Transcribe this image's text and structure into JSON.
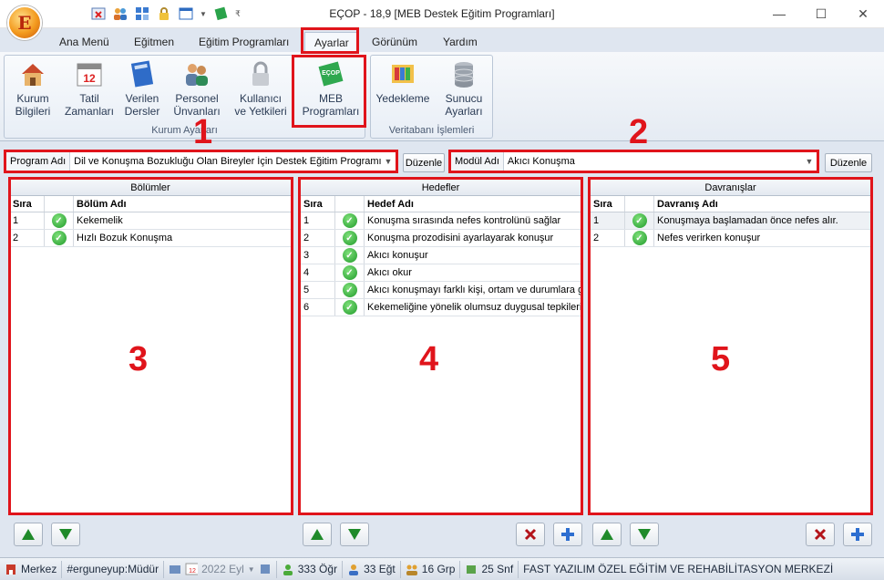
{
  "window": {
    "title": "EÇOP - 18,9 [MEB Destek Eğitim Programları]",
    "controls": [
      "minimize",
      "maximize",
      "close"
    ]
  },
  "app_orb_letter": "E",
  "qat_icons": [
    "delete-icon",
    "users-icon",
    "grid-icon",
    "lock-icon",
    "window-icon",
    "book-icon"
  ],
  "menu": {
    "tabs": [
      {
        "label": "Ana Menü"
      },
      {
        "label": "Eğitmen"
      },
      {
        "label": "Eğitim Programları"
      },
      {
        "label": "Ayarlar",
        "active": true
      },
      {
        "label": "Görünüm"
      },
      {
        "label": "Yardım"
      }
    ]
  },
  "ribbon": {
    "group1": {
      "label": "Kurum Ayarları",
      "buttons": [
        {
          "label1": "Kurum",
          "label2": "Bilgileri",
          "icon": "house-icon"
        },
        {
          "label1": "Tatil",
          "label2": "Zamanları",
          "icon": "calendar-icon"
        },
        {
          "label1": "Verilen",
          "label2": "Dersler",
          "icon": "book-icon"
        },
        {
          "label1": "Personel",
          "label2": "Ünvanları",
          "icon": "people-icon"
        },
        {
          "label1": "Kullanıcı",
          "label2": "ve Yetkileri",
          "icon": "lock-icon"
        },
        {
          "label1": "MEB",
          "label2": "Programları",
          "icon": "meb-book-icon"
        }
      ]
    },
    "group2": {
      "label": "Veritabanı İşlemleri",
      "buttons": [
        {
          "label1": "Yedekleme",
          "label2": "",
          "icon": "backup-icon"
        },
        {
          "label1": "Sunucu",
          "label2": "Ayarları",
          "icon": "database-icon"
        }
      ]
    }
  },
  "program": {
    "label": "Program Adı",
    "value": "Dil ve Konuşma Bozukluğu Olan Bireyler İçin Destek Eğitim Programı",
    "edit_label": "Düzenle"
  },
  "module": {
    "label": "Modül Adı",
    "value": "Akıcı Konuşma",
    "edit_label": "Düzenle"
  },
  "annotations": [
    "1",
    "2",
    "3",
    "4",
    "5"
  ],
  "panels": {
    "bolumler": {
      "title": "Bölümler",
      "col_sira": "Sıra",
      "col_name": "Bölüm Adı",
      "rows": [
        {
          "sira": "1",
          "name": "Kekemelik"
        },
        {
          "sira": "2",
          "name": "Hızlı Bozuk Konuşma"
        }
      ]
    },
    "hedefler": {
      "title": "Hedefler",
      "col_sira": "Sıra",
      "col_name": "Hedef Adı",
      "rows": [
        {
          "sira": "1",
          "name": "Konuşma sırasında nefes kontrolünü sağlar"
        },
        {
          "sira": "2",
          "name": "Konuşma prozodisini ayarlayarak konuşur"
        },
        {
          "sira": "3",
          "name": "Akıcı konuşur"
        },
        {
          "sira": "4",
          "name": "Akıcı okur"
        },
        {
          "sira": "5",
          "name": "Akıcı konuşmayı farklı kişi, ortam ve durumlara gen"
        },
        {
          "sira": "6",
          "name": "Kekemeliğine yönelik olumsuz duygusal tepkileriyle"
        }
      ]
    },
    "davranislar": {
      "title": "Davranışlar",
      "col_sira": "Sıra",
      "col_name": "Davranış Adı",
      "rows": [
        {
          "sira": "1",
          "name": "Konuşmaya başlamadan önce nefes alır."
        },
        {
          "sira": "2",
          "name": "Nefes verirken konuşur"
        }
      ]
    }
  },
  "status": {
    "branch": "Merkez",
    "user": "#ergunеyup:Müdür",
    "calendar_day": "12",
    "period": "2022 Eyl",
    "students": "333 Öğr",
    "teachers": "33 Eğt",
    "groups": "16 Grp",
    "classes": "25 Snf",
    "institution": "FAST YAZILIM ÖZEL EĞİTİM VE REHABİLİTASYON MERKEZİ"
  },
  "colors": {
    "annotation_red": "#e0141b",
    "check_green": "#1f9a2a",
    "ribbon_bg": "#e5ebf3"
  }
}
